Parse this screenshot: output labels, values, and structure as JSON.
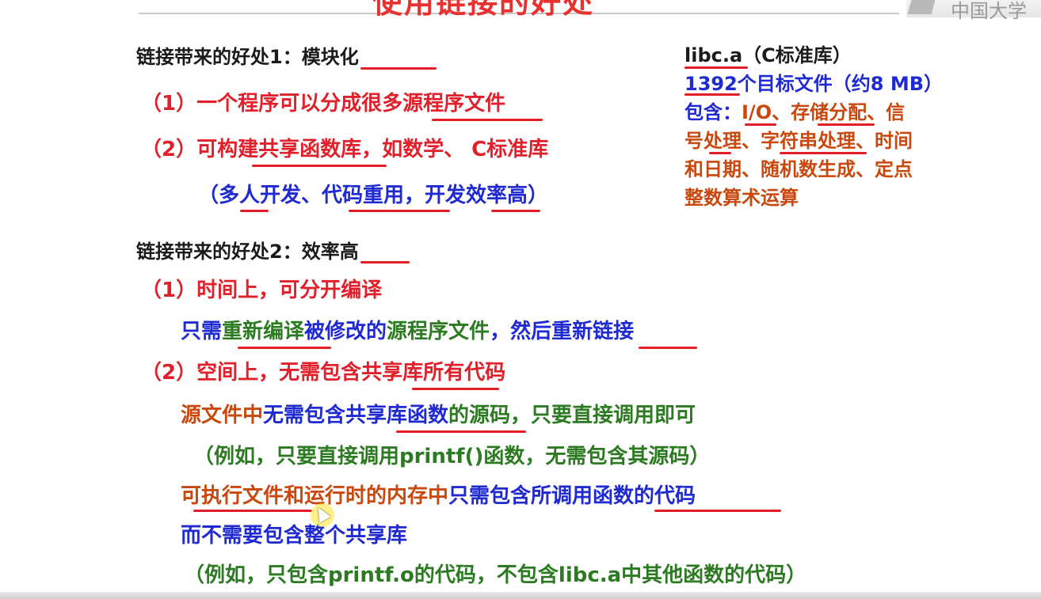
{
  "slide": {
    "title": "使用链接的好处"
  },
  "watermark": {
    "text": "中国大学"
  },
  "benefit1": {
    "heading_prefix": "链接带来的好处1：",
    "heading_key": "模块化",
    "item1": "（1）一个程序可以分成很多源程序文件",
    "item2": "（2）可构建共享函数库，如数学、 C标准库",
    "note": "（多人开发、代码重用，开发效率高）"
  },
  "libc": {
    "title": "libc.a（C标准库）",
    "count_value": "1392",
    "count_rest": "个目标文件（约8 MB）",
    "contains_label": "包含：",
    "contains_line1": "I/O、存储分配、信",
    "contains_line2": "号处理、字符串处理、时间",
    "contains_line3": "和日期、随机数生成、定点",
    "contains_line4": "整数算术运算"
  },
  "benefit2": {
    "heading_prefix": "链接带来的好处2：",
    "heading_key": "效率高",
    "item1": "（1）时间上，可分开编译",
    "item1_detail_blue1": "只需",
    "item1_detail_green1": "重新编译",
    "item1_detail_blue2": "被修改的",
    "item1_detail_green2": "源程序文件",
    "item1_detail_blue3": "，然后重新链接",
    "item2": "（2）空间上，无需包含共享库所有代码",
    "line_a_orange": "源文件中",
    "line_a_blue": "无需包含共享库函数",
    "line_a_green": "的源码，只要直接调用即可",
    "line_b": "（例如，只要直接调用printf()函数，无需包含其源码）",
    "line_c_orange": "可执行文件和运行时的内存中",
    "line_c_blue": "只需包含所调用函数的代码",
    "line_d": "而不需要包含整个共享库",
    "line_e": "（例如，只包含printf.o的代码，不包含libc.a中其他函数的代码）"
  },
  "colors": {
    "heading": "#1b1b1b",
    "red": "#e0202a",
    "blue": "#1f2ad0",
    "green": "#2c7a22",
    "orange": "#c9480e"
  }
}
